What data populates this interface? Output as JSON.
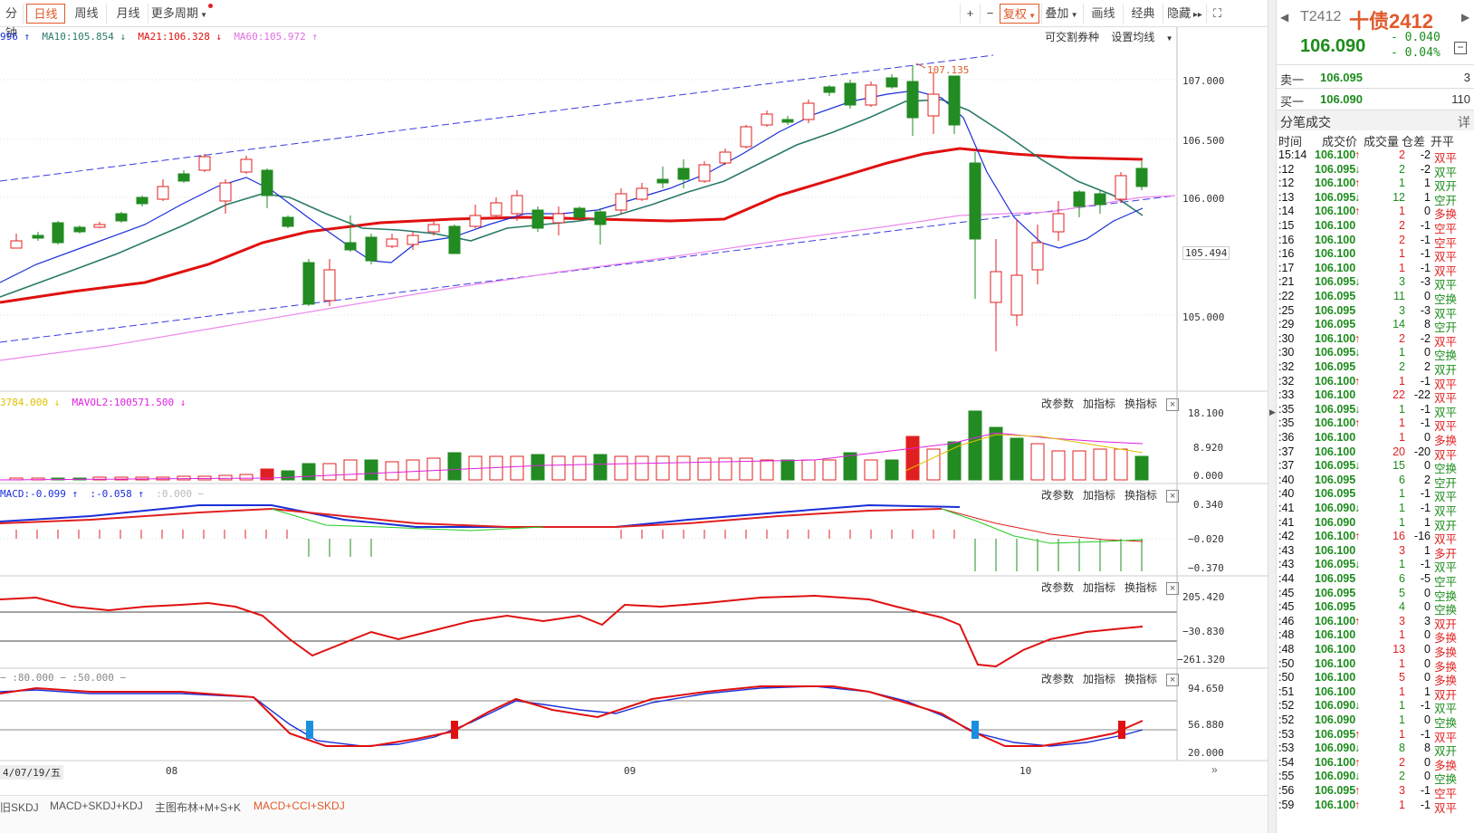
{
  "toolbar": {
    "tabs": [
      "分钟",
      "日线",
      "周线",
      "月线",
      "更多周期"
    ],
    "active_tab": "日线",
    "right_buttons": [
      "+",
      "−",
      "复权",
      "叠加",
      "画线",
      "经典",
      "隐藏"
    ],
    "fuquan_label": "复权"
  },
  "ma_legend": {
    "ma5": "996 ↑",
    "ma10": "MA10:105.854 ↓",
    "ma21": "MA21:106.328 ↓",
    "ma60": "MA60:105.972 ↑"
  },
  "main_tools": {
    "convertible": "可交割券种",
    "set_ma": "设置均线"
  },
  "price_axis": {
    "labels": [
      "107.000",
      "106.500",
      "106.000",
      "105.494",
      "105.000"
    ],
    "high_marker": "107.135"
  },
  "vol_legend": {
    "vol": "3784.000 ↓",
    "mavol2": "MAVOL2:100571.500 ↓"
  },
  "vol_axis": [
    "18.100",
    "8.920",
    "0.000"
  ],
  "macd_legend": {
    "macd": "MACD:-0.099 ↑",
    "dif": ":-0.058 ↑",
    "dea": ":0.000 −"
  },
  "macd_axis": [
    "0.340",
    "−0.020",
    "−0.370"
  ],
  "cci_axis": [
    "205.420",
    "−30.830",
    "−261.320"
  ],
  "skdj_legend": {
    "a": "− :80.000 − :50.000 −"
  },
  "skdj_axis": [
    "94.650",
    "56.880",
    "20.000"
  ],
  "panel_tools": [
    "改参数",
    "加指标",
    "换指标"
  ],
  "x_axis": {
    "date_label": "4/07/19/五",
    "months": [
      "08",
      "09",
      "10"
    ]
  },
  "bottom_tabs": [
    "旧SKDJ",
    "MACD+SKDJ+KDJ",
    "主图布林+M+S+K",
    "MACD+CCI+SKDJ"
  ],
  "active_bottom_tab": "MACD+CCI+SKDJ",
  "quote": {
    "symbol": "T2412",
    "name": "十债2412",
    "price": "106.090",
    "change": "- 0.040",
    "change_pct": "- 0.04%",
    "sell1_label": "卖一",
    "sell1_price": "106.095",
    "sell1_vol": "3",
    "buy1_label": "买一",
    "buy1_price": "106.090",
    "buy1_vol": "110"
  },
  "ticks_panel": {
    "title": "分笔成交",
    "detail": "详",
    "headers": [
      "时间",
      "成交价",
      "成交量",
      "仓差",
      "开平"
    ]
  },
  "ticks": [
    {
      "t": "15:14",
      "p": "106.100",
      "a": "↑",
      "v": "2",
      "d": "-2",
      "o": "双平",
      "pc": "g",
      "oc": "r"
    },
    {
      "t": ":12",
      "p": "106.095",
      "a": "↓",
      "v": "2",
      "d": "-2",
      "o": "双平",
      "pc": "g",
      "oc": "g"
    },
    {
      "t": ":12",
      "p": "106.100",
      "a": "↑",
      "v": "1",
      "d": "1",
      "o": "双开",
      "pc": "g",
      "oc": "g"
    },
    {
      "t": ":13",
      "p": "106.095",
      "a": "↓",
      "v": "12",
      "d": "1",
      "o": "空开",
      "pc": "g",
      "oc": "g"
    },
    {
      "t": ":14",
      "p": "106.100",
      "a": "↑",
      "v": "1",
      "d": "0",
      "o": "多换",
      "pc": "g",
      "oc": "r"
    },
    {
      "t": ":15",
      "p": "106.100",
      "a": "",
      "v": "2",
      "d": "-1",
      "o": "空平",
      "pc": "g",
      "oc": "r"
    },
    {
      "t": ":16",
      "p": "106.100",
      "a": "",
      "v": "2",
      "d": "-1",
      "o": "空平",
      "pc": "g",
      "oc": "r"
    },
    {
      "t": ":16",
      "p": "106.100",
      "a": "",
      "v": "1",
      "d": "-1",
      "o": "双平",
      "pc": "g",
      "oc": "r"
    },
    {
      "t": ":17",
      "p": "106.100",
      "a": "",
      "v": "1",
      "d": "-1",
      "o": "双平",
      "pc": "g",
      "oc": "r"
    },
    {
      "t": ":21",
      "p": "106.095",
      "a": "↓",
      "v": "3",
      "d": "-3",
      "o": "双平",
      "pc": "g",
      "oc": "g"
    },
    {
      "t": ":22",
      "p": "106.095",
      "a": "",
      "v": "11",
      "d": "0",
      "o": "空换",
      "pc": "g",
      "oc": "g"
    },
    {
      "t": ":25",
      "p": "106.095",
      "a": "",
      "v": "3",
      "d": "-3",
      "o": "双平",
      "pc": "g",
      "oc": "g"
    },
    {
      "t": ":29",
      "p": "106.095",
      "a": "",
      "v": "14",
      "d": "8",
      "o": "空开",
      "pc": "g",
      "oc": "g"
    },
    {
      "t": ":30",
      "p": "106.100",
      "a": "↑",
      "v": "2",
      "d": "-2",
      "o": "双平",
      "pc": "g",
      "oc": "r"
    },
    {
      "t": ":30",
      "p": "106.095",
      "a": "↓",
      "v": "1",
      "d": "0",
      "o": "空换",
      "pc": "g",
      "oc": "g"
    },
    {
      "t": ":32",
      "p": "106.095",
      "a": "",
      "v": "2",
      "d": "2",
      "o": "双开",
      "pc": "g",
      "oc": "g"
    },
    {
      "t": ":32",
      "p": "106.100",
      "a": "↑",
      "v": "1",
      "d": "-1",
      "o": "双平",
      "pc": "g",
      "oc": "r"
    },
    {
      "t": ":33",
      "p": "106.100",
      "a": "",
      "v": "22",
      "d": "-22",
      "o": "双平",
      "pc": "g",
      "oc": "r"
    },
    {
      "t": ":35",
      "p": "106.095",
      "a": "↓",
      "v": "1",
      "d": "-1",
      "o": "双平",
      "pc": "g",
      "oc": "g"
    },
    {
      "t": ":35",
      "p": "106.100",
      "a": "↑",
      "v": "1",
      "d": "-1",
      "o": "双平",
      "pc": "g",
      "oc": "r"
    },
    {
      "t": ":36",
      "p": "106.100",
      "a": "",
      "v": "1",
      "d": "0",
      "o": "多换",
      "pc": "g",
      "oc": "r"
    },
    {
      "t": ":37",
      "p": "106.100",
      "a": "",
      "v": "20",
      "d": "-20",
      "o": "双平",
      "pc": "g",
      "oc": "r"
    },
    {
      "t": ":37",
      "p": "106.095",
      "a": "↓",
      "v": "15",
      "d": "0",
      "o": "空换",
      "pc": "g",
      "oc": "g"
    },
    {
      "t": ":40",
      "p": "106.095",
      "a": "",
      "v": "6",
      "d": "2",
      "o": "空开",
      "pc": "g",
      "oc": "g"
    },
    {
      "t": ":40",
      "p": "106.095",
      "a": "",
      "v": "1",
      "d": "-1",
      "o": "双平",
      "pc": "g",
      "oc": "g"
    },
    {
      "t": ":41",
      "p": "106.090",
      "a": "↓",
      "v": "1",
      "d": "-1",
      "o": "双平",
      "pc": "g",
      "oc": "g"
    },
    {
      "t": ":41",
      "p": "106.090",
      "a": "",
      "v": "1",
      "d": "1",
      "o": "双开",
      "pc": "g",
      "oc": "g"
    },
    {
      "t": ":42",
      "p": "106.100",
      "a": "↑",
      "v": "16",
      "d": "-16",
      "o": "双平",
      "pc": "g",
      "oc": "r"
    },
    {
      "t": ":43",
      "p": "106.100",
      "a": "",
      "v": "3",
      "d": "1",
      "o": "多开",
      "pc": "g",
      "oc": "r"
    },
    {
      "t": ":43",
      "p": "106.095",
      "a": "↓",
      "v": "1",
      "d": "-1",
      "o": "双平",
      "pc": "g",
      "oc": "g"
    },
    {
      "t": ":44",
      "p": "106.095",
      "a": "",
      "v": "6",
      "d": "-5",
      "o": "空平",
      "pc": "g",
      "oc": "g"
    },
    {
      "t": ":45",
      "p": "106.095",
      "a": "",
      "v": "5",
      "d": "0",
      "o": "空换",
      "pc": "g",
      "oc": "g"
    },
    {
      "t": ":45",
      "p": "106.095",
      "a": "",
      "v": "4",
      "d": "0",
      "o": "空换",
      "pc": "g",
      "oc": "g"
    },
    {
      "t": ":46",
      "p": "106.100",
      "a": "↑",
      "v": "3",
      "d": "3",
      "o": "双开",
      "pc": "g",
      "oc": "r"
    },
    {
      "t": ":48",
      "p": "106.100",
      "a": "",
      "v": "1",
      "d": "0",
      "o": "多换",
      "pc": "g",
      "oc": "r"
    },
    {
      "t": ":48",
      "p": "106.100",
      "a": "",
      "v": "13",
      "d": "0",
      "o": "多换",
      "pc": "g",
      "oc": "r"
    },
    {
      "t": ":50",
      "p": "106.100",
      "a": "",
      "v": "1",
      "d": "0",
      "o": "多换",
      "pc": "g",
      "oc": "r"
    },
    {
      "t": ":50",
      "p": "106.100",
      "a": "",
      "v": "5",
      "d": "0",
      "o": "多换",
      "pc": "g",
      "oc": "r"
    },
    {
      "t": ":51",
      "p": "106.100",
      "a": "",
      "v": "1",
      "d": "1",
      "o": "双开",
      "pc": "g",
      "oc": "r"
    },
    {
      "t": ":52",
      "p": "106.090",
      "a": "↓",
      "v": "1",
      "d": "-1",
      "o": "双平",
      "pc": "g",
      "oc": "g"
    },
    {
      "t": ":52",
      "p": "106.090",
      "a": "",
      "v": "1",
      "d": "0",
      "o": "空换",
      "pc": "g",
      "oc": "g"
    },
    {
      "t": ":53",
      "p": "106.095",
      "a": "↑",
      "v": "1",
      "d": "-1",
      "o": "双平",
      "pc": "g",
      "oc": "r"
    },
    {
      "t": ":53",
      "p": "106.090",
      "a": "↓",
      "v": "8",
      "d": "8",
      "o": "双开",
      "pc": "g",
      "oc": "g"
    },
    {
      "t": ":54",
      "p": "106.100",
      "a": "↑",
      "v": "2",
      "d": "0",
      "o": "多换",
      "pc": "g",
      "oc": "r"
    },
    {
      "t": ":55",
      "p": "106.090",
      "a": "↓",
      "v": "2",
      "d": "0",
      "o": "空换",
      "pc": "g",
      "oc": "g"
    },
    {
      "t": ":56",
      "p": "106.095",
      "a": "↑",
      "v": "3",
      "d": "-1",
      "o": "空平",
      "pc": "g",
      "oc": "r"
    },
    {
      "t": ":59",
      "p": "106.100",
      "a": "↑",
      "v": "1",
      "d": "-1",
      "o": "双平",
      "pc": "g",
      "oc": "r"
    }
  ]
}
